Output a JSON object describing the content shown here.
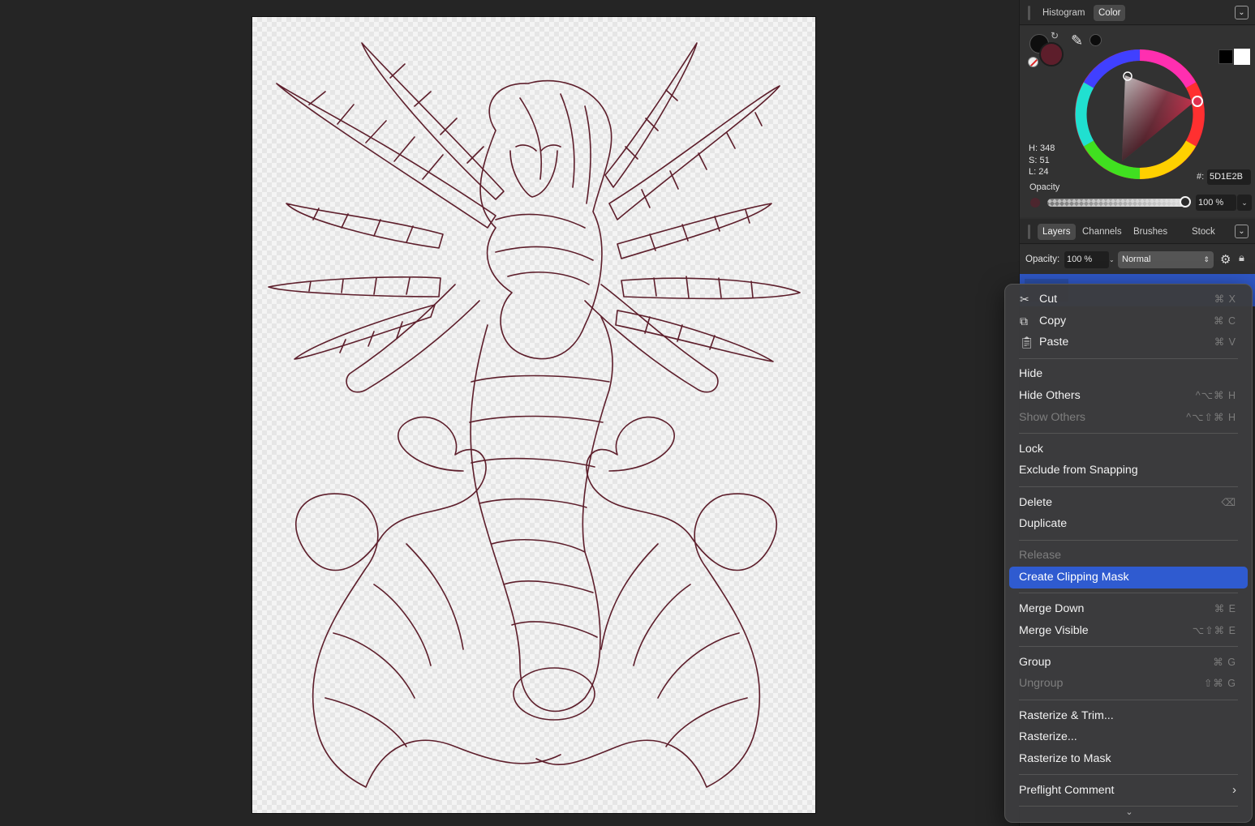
{
  "panel": {
    "top_tabs": [
      "Histogram",
      "Color"
    ],
    "color": {
      "hsl": [
        "H: 348",
        "S: 51",
        "L: 24"
      ],
      "hex_label": "#:",
      "hex_value": "5D1E2B",
      "opacity_label": "Opacity",
      "opacity_value": "100 %",
      "opacity_fraction": 1.0,
      "current_color": "#5D1E2B"
    },
    "layer_tabs": [
      "Layers",
      "Channels",
      "Brushes",
      "Stock"
    ],
    "layers": {
      "opacity_label": "Opacity:",
      "opacity_value": "100 %",
      "blend_mode": "Normal"
    }
  },
  "context_menu": {
    "groups": [
      [
        {
          "label": "Cut",
          "shortcut": "⌘ X",
          "icon": "scissors-icon"
        },
        {
          "label": "Copy",
          "shortcut": "⌘ C",
          "icon": "copy-icon"
        },
        {
          "label": "Paste",
          "shortcut": "⌘ V",
          "icon": "paste-icon"
        }
      ],
      [
        {
          "label": "Hide",
          "shortcut": ""
        },
        {
          "label": "Hide Others",
          "shortcut": "^⌥⌘ H"
        },
        {
          "label": "Show Others",
          "shortcut": "^⌥⇧⌘ H",
          "disabled": true
        }
      ],
      [
        {
          "label": "Lock",
          "shortcut": ""
        },
        {
          "label": "Exclude from Snapping",
          "shortcut": ""
        }
      ],
      [
        {
          "label": "Delete",
          "shortcut": "⌫"
        },
        {
          "label": "Duplicate",
          "shortcut": ""
        }
      ],
      [
        {
          "label": "Release",
          "shortcut": "",
          "disabled": true
        },
        {
          "label": "Create Clipping Mask",
          "shortcut": "",
          "highlighted": true
        }
      ],
      [
        {
          "label": "Merge Down",
          "shortcut": "⌘ E"
        },
        {
          "label": "Merge Visible",
          "shortcut": "⌥⇧⌘ E"
        }
      ],
      [
        {
          "label": "Group",
          "shortcut": "⌘ G"
        },
        {
          "label": "Ungroup",
          "shortcut": "⇧⌘ G",
          "disabled": true
        }
      ],
      [
        {
          "label": "Rasterize & Trim...",
          "shortcut": ""
        },
        {
          "label": "Rasterize...",
          "shortcut": ""
        },
        {
          "label": "Rasterize to Mask",
          "shortcut": ""
        }
      ],
      [
        {
          "label": "Preflight Comment",
          "shortcut": "",
          "submenu": true
        }
      ]
    ]
  },
  "colors": {
    "accent": "#2f5bd0",
    "line_art": "#5D1E2B"
  }
}
